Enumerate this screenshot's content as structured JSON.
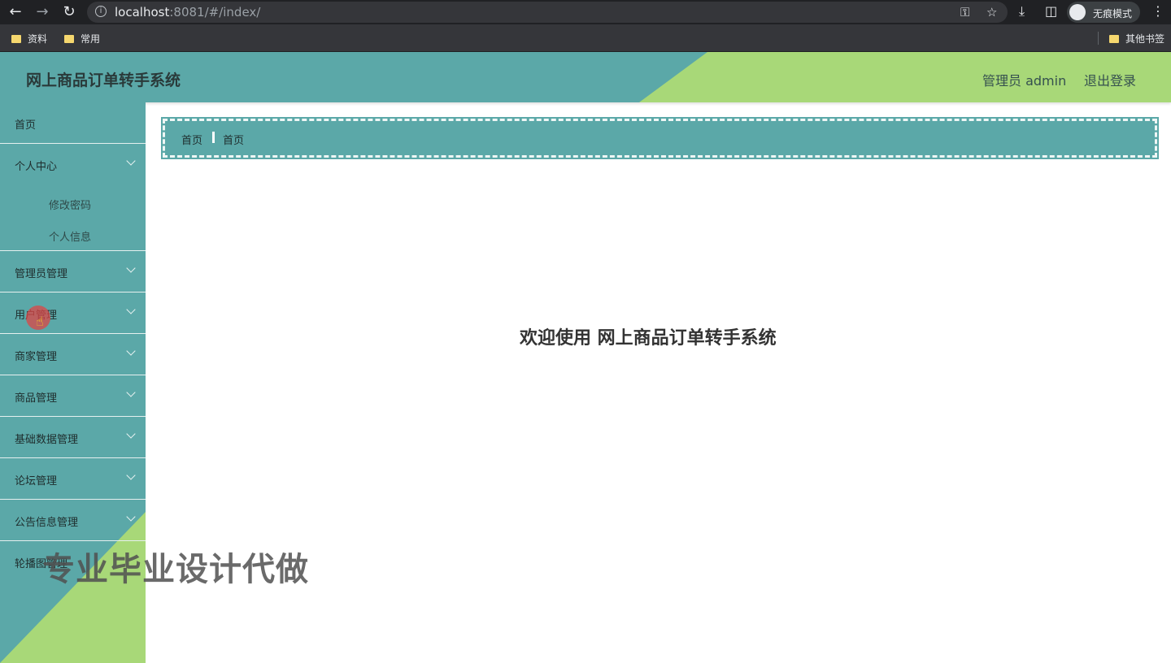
{
  "browser": {
    "url_host": "localhost",
    "url_rest": ":8081/#/index/",
    "profile_label": "无痕模式",
    "bookmarks": [
      "资料",
      "常用"
    ],
    "other_bookmarks": "其他书签",
    "icons": [
      "back-icon",
      "forward-icon",
      "reload-icon",
      "info-icon",
      "key-icon",
      "star-icon",
      "download-icon",
      "sidebar-icon",
      "incognito-icon",
      "more-icon"
    ]
  },
  "header": {
    "title": "网上商品订单转手系统",
    "user": "管理员 admin",
    "logout": "退出登录"
  },
  "sidebar": {
    "items": [
      {
        "label": "首页"
      },
      {
        "label": "个人中心",
        "children": [
          "修改密码",
          "个人信息"
        ]
      },
      {
        "label": "管理员管理"
      },
      {
        "label": "用户管理"
      },
      {
        "label": "商家管理"
      },
      {
        "label": "商品管理"
      },
      {
        "label": "基础数据管理"
      },
      {
        "label": "论坛管理"
      },
      {
        "label": "公告信息管理"
      },
      {
        "label": "轮播图管理"
      }
    ]
  },
  "breadcrumb": [
    "首页",
    "首页"
  ],
  "main": {
    "welcome": "欢迎使用 网上商品订单转手系统"
  },
  "watermark": "专业毕业设计代做",
  "colors": {
    "teal": "#5ba8a8",
    "green": "#a8d878"
  }
}
